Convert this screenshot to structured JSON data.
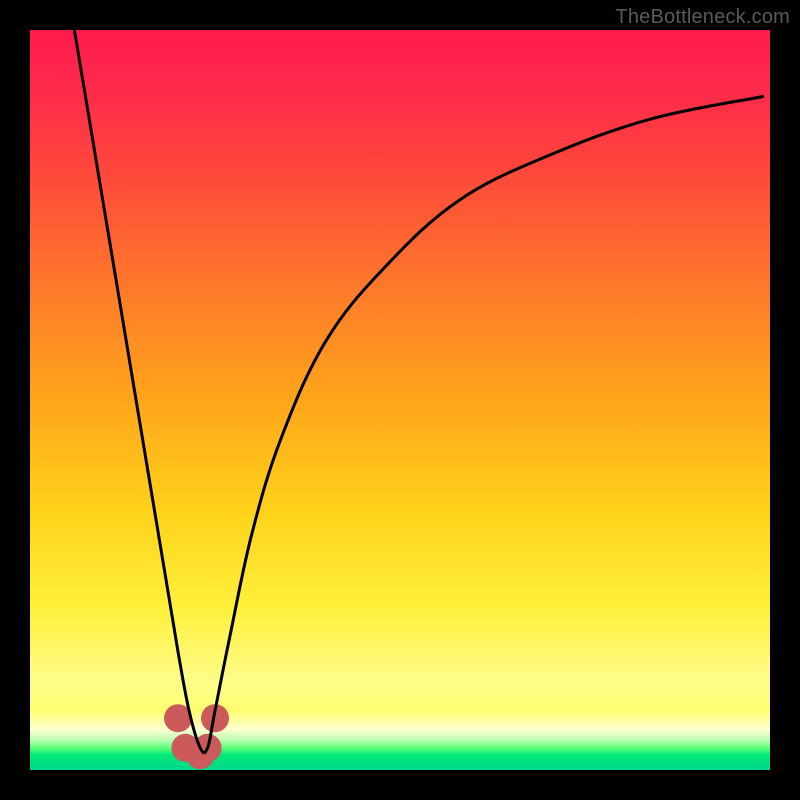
{
  "watermark": "TheBottleneck.com",
  "chart_data": {
    "type": "line",
    "title": "",
    "xlabel": "",
    "ylabel": "",
    "xlim": [
      0,
      100
    ],
    "ylim": [
      0,
      100
    ],
    "grid": false,
    "series": [
      {
        "name": "bottleneck-curve",
        "x": [
          6,
          8,
          10,
          12,
          14,
          16,
          18,
          20,
          21.5,
          23,
          24,
          25,
          27,
          30,
          34,
          40,
          48,
          58,
          70,
          84,
          99
        ],
        "values": [
          100,
          88,
          76,
          64,
          52,
          40,
          28,
          16,
          8,
          3,
          3,
          8,
          18,
          32,
          45,
          58,
          68,
          77,
          83,
          88,
          91
        ]
      }
    ],
    "markers": {
      "name": "bottom-marker",
      "x": [
        20,
        21,
        23,
        24,
        25
      ],
      "y": [
        7,
        3,
        2,
        3,
        7
      ],
      "color": "#cc5a5a",
      "size": 14
    },
    "colors": {
      "curve": "#000000",
      "background_top": "#ff1a4d",
      "background_bottom": "#00d98a"
    }
  }
}
